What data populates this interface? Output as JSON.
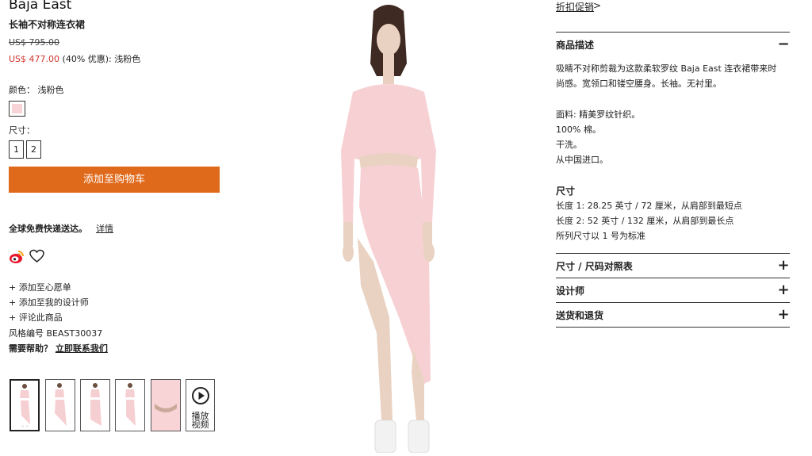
{
  "product": {
    "brand": "Baja East",
    "name": "长袖不对称连衣裙",
    "original_price": "US$ 795.00",
    "sale_price": "US$ 477.00",
    "discount": "(40% 优惠):",
    "price_color_name": "浅粉色",
    "color_label": "颜色：",
    "color_value": "浅粉色",
    "swatch_color": "#f8d4d6",
    "size_label": "尺寸：",
    "sizes": [
      "1",
      "2"
    ],
    "add_to_cart": "添加至购物车",
    "accent_color": "#e06a1b",
    "sale_color": "#d0342c"
  },
  "shipping": {
    "text": "全球免费快递送达。",
    "link": "详情"
  },
  "social": {
    "icons": [
      "weibo-icon",
      "heart-icon"
    ]
  },
  "actions": [
    "+ 添加至心愿单",
    "+ 添加至我的设计师",
    "+ 评论此商品"
  ],
  "style_number": "风格编号 BEAST30037",
  "help": {
    "prefix": "需要帮助？",
    "link": "立即联系我们"
  },
  "video": {
    "label_line1": "播放",
    "label_line2": "视频"
  },
  "promo": {
    "link": "折扣促销",
    "arrow": ">"
  },
  "details": {
    "description_title": "商品描述",
    "description_toggle": "−",
    "description_lines": [
      "吸睛不对称剪裁为这款柔软罗纹 Baja East 连衣裙带来时",
      "尚感。宽领口和镂空腰身。长袖。无衬里。"
    ],
    "material_lines": [
      "面料: 精美罗纹针织。",
      "100% 棉。",
      "干洗。",
      "从中国进口。"
    ],
    "size_title": "尺寸",
    "size_lines": [
      "长度 1: 28.25 英寸 / 72 厘米，从肩部到最短点",
      "长度 2: 52 英寸 / 132 厘米，从肩部到最长点",
      "所列尺寸以 1 号为标准"
    ],
    "sections": [
      {
        "title": "尺寸 / 尺码对照表",
        "toggle": "+"
      },
      {
        "title": "设计师",
        "toggle": "+"
      },
      {
        "title": "送货和退货",
        "toggle": "+"
      }
    ]
  }
}
